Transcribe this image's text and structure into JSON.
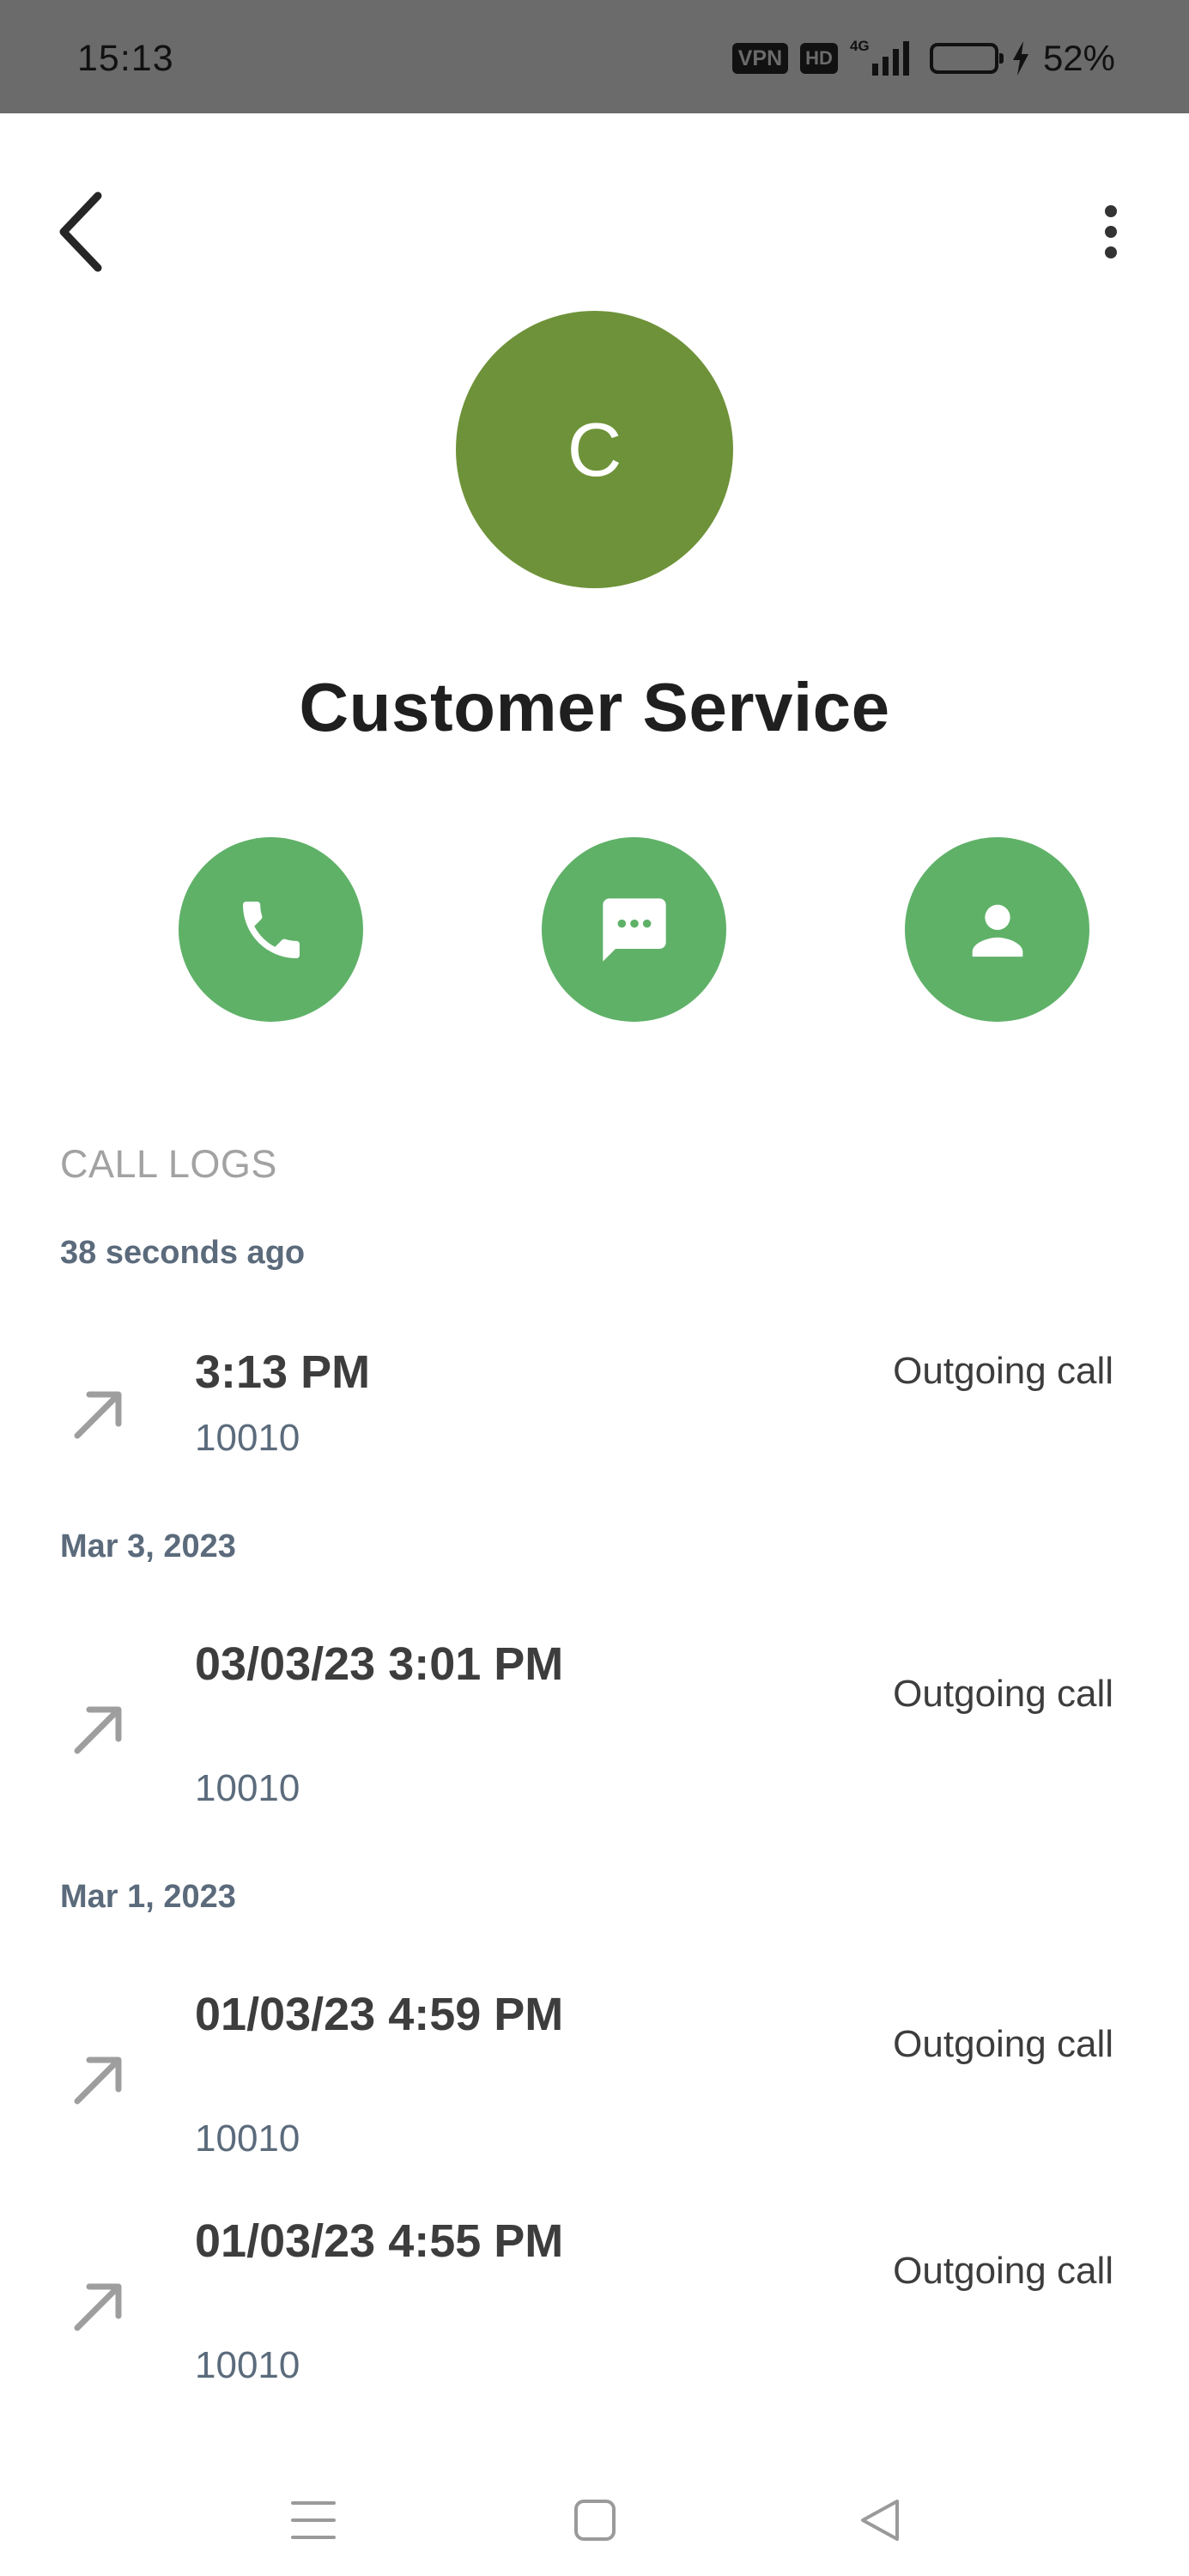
{
  "status_bar": {
    "time": "15:13",
    "vpn_label": "VPN",
    "hd_label": "HD",
    "network_label": "4G",
    "battery_percent": "52%",
    "battery_level": 0.52,
    "icons": [
      "vpn-icon",
      "hd-icon",
      "signal-icon",
      "battery-icon",
      "charging-icon"
    ]
  },
  "toolbar": {
    "back_icon": "back-arrow-icon",
    "more_icon": "more-vert-icon"
  },
  "contact": {
    "initial": "C",
    "name": "Customer Service",
    "avatar_color": "#6e9239"
  },
  "actions": [
    {
      "name": "call",
      "icon": "phone-icon",
      "color": "#5fb168"
    },
    {
      "name": "message",
      "icon": "message-icon",
      "color": "#5fb168"
    },
    {
      "name": "contact",
      "icon": "person-icon",
      "color": "#5fb168"
    }
  ],
  "call_logs": {
    "title": "CALL LOGS",
    "groups": [
      {
        "date": "38 seconds ago",
        "entries": [
          {
            "time": "3:13 PM",
            "number": "10010",
            "type": "Outgoing call",
            "icon": "outgoing-call-arrow-icon"
          }
        ]
      },
      {
        "date": "Mar 3, 2023",
        "entries": [
          {
            "time": "03/03/23 3:01 PM",
            "number": "10010",
            "type": "Outgoing call",
            "icon": "outgoing-call-arrow-icon"
          }
        ]
      },
      {
        "date": "Mar 1, 2023",
        "entries": [
          {
            "time": "01/03/23 4:59 PM",
            "number": "10010",
            "type": "Outgoing call",
            "icon": "outgoing-call-arrow-icon"
          },
          {
            "time": "01/03/23 4:55 PM",
            "number": "10010",
            "type": "Outgoing call",
            "icon": "outgoing-call-arrow-icon"
          }
        ]
      }
    ]
  },
  "nav_bar": {
    "icons": [
      "menu-icon",
      "home-square-icon",
      "back-triangle-icon"
    ]
  }
}
